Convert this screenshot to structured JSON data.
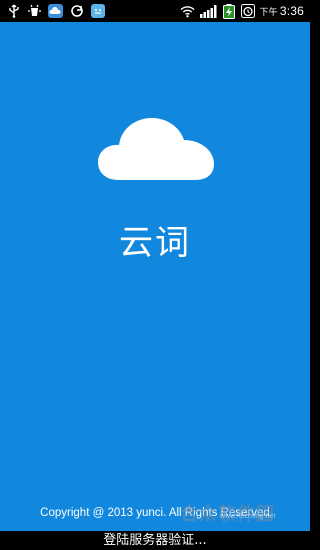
{
  "status_bar": {
    "left_icons": [
      "usb-icon",
      "debug-icon",
      "weather-icon",
      "sync-icon",
      "app-icon"
    ],
    "right_icons": [
      "wifi-icon",
      "signal-icon",
      "battery-charging-icon",
      "alarm-icon"
    ],
    "clock_prefix": "下午",
    "clock": "3:36"
  },
  "splash": {
    "background_color": "#1287de",
    "logo_icon": "cloud-icon",
    "app_name": "云词",
    "copyright": "Copyright @ 2013 yunci. All Rights Reserved"
  },
  "watermark": {
    "logo_text": "合众软件园",
    "url": "www.hezhong.net"
  },
  "toast": {
    "message": "登陆服务器验证..."
  }
}
